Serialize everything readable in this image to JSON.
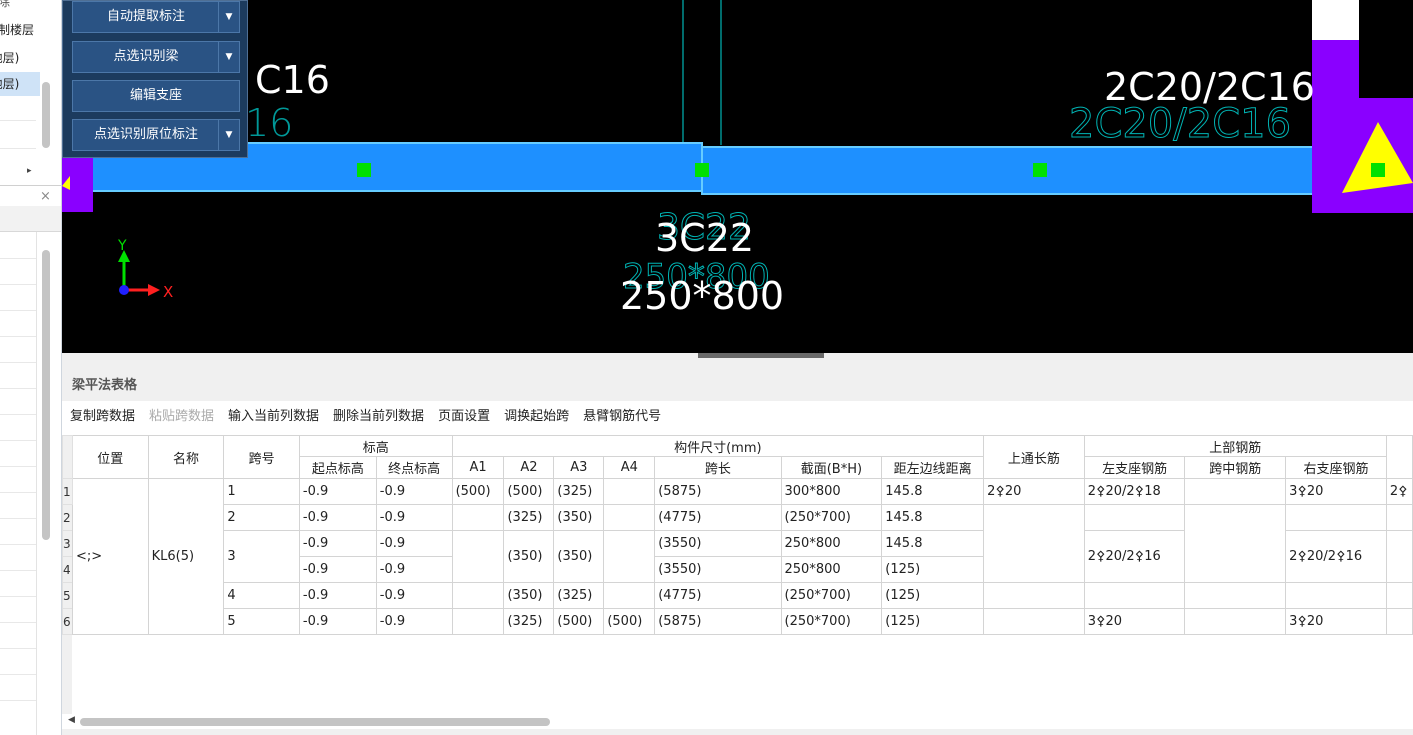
{
  "left_panel": {
    "top_label": "删除",
    "items": [
      {
        "label": "复制楼层",
        "selected": false
      },
      {
        "label": "(地层)",
        "selected": false
      },
      {
        "label": "(地层)",
        "selected": true
      }
    ],
    "close_symbol": "×",
    "arrow_symbol": "▸"
  },
  "float_menu": {
    "buttons": [
      {
        "label": "自动提取标注",
        "has_dropdown": true
      },
      {
        "label": "点选识别梁",
        "has_dropdown": true
      },
      {
        "label": "编辑支座",
        "has_dropdown": false
      },
      {
        "label": "点选识别原位标注",
        "has_dropdown": true
      }
    ],
    "dropdown_symbol": "▼"
  },
  "cad": {
    "labels": {
      "left_top_partial": "C16",
      "left_top_ghost": "16",
      "right_top": "2C20/2C16",
      "right_top_ghost": "2C20/2C16",
      "bottom_rebar": "3C22",
      "bottom_rebar_ghost": "3C22",
      "section": "250*800",
      "section_ghost": "250*800",
      "axis_x": "X",
      "axis_y": "Y"
    },
    "colors": {
      "beam": "#1e90ff",
      "beam_edge": "#66ccff",
      "support": "#8a00ff",
      "marker": "#00e000",
      "triangle": "#ffff00",
      "ghost_text": "#00b3b3"
    }
  },
  "panel": {
    "title": "梁平法表格",
    "toolbar": [
      {
        "label": "复制跨数据",
        "enabled": true
      },
      {
        "label": "粘贴跨数据",
        "enabled": false
      },
      {
        "label": "输入当前列数据",
        "enabled": true
      },
      {
        "label": "删除当前列数据",
        "enabled": true
      },
      {
        "label": "页面设置",
        "enabled": true
      },
      {
        "label": "调换起始跨",
        "enabled": true
      },
      {
        "label": "悬臂钢筋代号",
        "enabled": true
      }
    ]
  },
  "table": {
    "headers": {
      "position": "位置",
      "name": "名称",
      "span_no": "跨号",
      "elevation": "标高",
      "start_elev": "起点标高",
      "end_elev": "终点标高",
      "dims": "构件尺寸(mm)",
      "a1": "A1",
      "a2": "A2",
      "a3": "A3",
      "a4": "A4",
      "span_len": "跨长",
      "section": "截面(B*H)",
      "left_edge": "距左边线距离",
      "top_through": "上通长筋",
      "top_bars": "上部钢筋",
      "left_support": "左支座钢筋",
      "mid_span": "跨中钢筋",
      "right_support": "右支座钢筋"
    },
    "position_value": "<;>",
    "name_value": "KL6(5)",
    "row_numbers": [
      "1",
      "2",
      "3",
      "4",
      "5",
      "6"
    ],
    "rows": [
      {
        "span": "1",
        "start": "-0.9",
        "end": "-0.9",
        "a1": "(500)",
        "a2": "(500)",
        "a3": "(325)",
        "a4": "",
        "len": "(5875)",
        "section": "300*800",
        "dist": "145.8",
        "top_through": "2⚴20",
        "left_support": "2⚴20/2⚴18",
        "mid": "",
        "right_support": "3⚴20",
        "extra": "2⚴"
      },
      {
        "span": "2",
        "start": "-0.9",
        "end": "-0.9",
        "a1": "",
        "a2": "(325)",
        "a3": "(350)",
        "a4": "",
        "len": "(4775)",
        "section": "(250*700)",
        "dist": "145.8",
        "top_through": "",
        "left_support": "",
        "mid": "",
        "right_support": "",
        "extra": ""
      },
      {
        "span": "3",
        "start": "-0.9",
        "end": "-0.9",
        "a1": "",
        "a2": "(350)",
        "a3": "(350)",
        "a4": "",
        "len": "(3550)",
        "section": "250*800",
        "dist": "145.8",
        "top_through": "",
        "left_support": "2⚴20/2⚴16",
        "mid": "",
        "right_support": "2⚴20/2⚴16",
        "extra": ""
      },
      {
        "span": "",
        "start": "-0.9",
        "end": "-0.9",
        "len": "(3550)",
        "section": "250*800",
        "dist": "(125)"
      },
      {
        "span": "4",
        "start": "-0.9",
        "end": "-0.9",
        "a1": "",
        "a2": "(350)",
        "a3": "(325)",
        "a4": "",
        "len": "(4775)",
        "section": "(250*700)",
        "dist": "(125)",
        "top_through": "",
        "left_support": "",
        "mid": "",
        "right_support": "",
        "extra": ""
      },
      {
        "span": "5",
        "start": "-0.9",
        "end": "-0.9",
        "a1": "",
        "a2": "(325)",
        "a3": "(500)",
        "a4": "(500)",
        "len": "(5875)",
        "section": "(250*700)",
        "dist": "(125)",
        "top_through": "",
        "left_support": "3⚴20",
        "mid": "",
        "right_support": "3⚴20",
        "extra": ""
      }
    ]
  }
}
